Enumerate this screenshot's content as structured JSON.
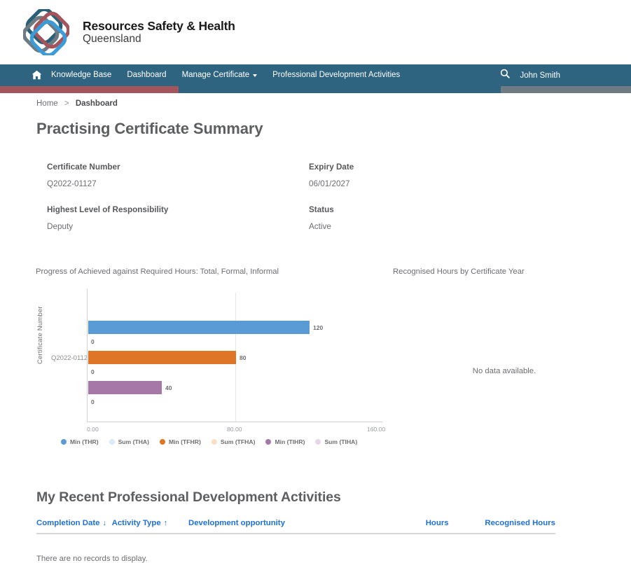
{
  "brand": {
    "line1": "Resources Safety & Health",
    "line2": "Queensland",
    "logo_colors": {
      "teal": "#2a6077",
      "grey": "#6f7b82",
      "red": "#a4555c",
      "blue": "#3b9cd9"
    }
  },
  "nav": {
    "home_icon": "home-icon",
    "items": [
      {
        "label": "Knowledge Base",
        "has_caret": false
      },
      {
        "label": "Dashboard",
        "has_caret": false
      },
      {
        "label": "Manage Certificate",
        "has_caret": true
      },
      {
        "label": "Professional Development Activities",
        "has_caret": false
      }
    ],
    "search_icon": "search-icon",
    "user": "John Smith",
    "user_caret": "▾",
    "bar_color": "#2e6480"
  },
  "stripe": {
    "red": "#a4555c",
    "teal": "#2e6480",
    "grey": "#6f7b82"
  },
  "breadcrumb": {
    "home": "Home",
    "separator": ">",
    "current": "Dashboard"
  },
  "page": {
    "title": "Practising Certificate Summary"
  },
  "details": [
    {
      "label": "Certificate Number",
      "value": "Q2022-01127"
    },
    {
      "label": "Expiry Date",
      "value": "06/01/2027"
    },
    {
      "label": "Highest Level of Responsibility",
      "value": "Deputy"
    },
    {
      "label": "Status",
      "value": "Active"
    }
  ],
  "charts": {
    "left_caption": "Progress of Achieved against Required Hours: Total, Formal, Informal",
    "right_caption": "Recognised Hours by Certificate Year",
    "no_data_message": "No data available."
  },
  "chart_data": {
    "type": "bar",
    "orientation": "horizontal",
    "title": "Progress of Achieved against Required Hours: Total, Formal, Informal",
    "xlabel": "",
    "ylabel": "Certificate Number",
    "categories": [
      "Q2022-01127"
    ],
    "xlim": [
      0,
      160
    ],
    "xticks": [
      "0.00",
      "80.00",
      "160.00"
    ],
    "xtick_values": [
      0,
      80,
      160
    ],
    "grid": "vertical-at-80",
    "legend_position": "bottom",
    "series": [
      {
        "name": "Min (THR)",
        "color": "#5b9bd5",
        "values": [
          120
        ],
        "label": "120"
      },
      {
        "name": "Sum (THA)",
        "color": "#dce9f6",
        "values": [
          0
        ],
        "label": "0"
      },
      {
        "name": "Min (TFHR)",
        "color": "#df7526",
        "values": [
          80
        ],
        "label": "80"
      },
      {
        "name": "Sum (TFHA)",
        "color": "#fadfc5",
        "values": [
          0
        ],
        "label": "0"
      },
      {
        "name": "Min (TIHR)",
        "color": "#a678a8",
        "values": [
          40
        ],
        "label": "40"
      },
      {
        "name": "Sum (TIHA)",
        "color": "#e6d7e7",
        "values": [
          0
        ],
        "label": "0"
      }
    ]
  },
  "activities": {
    "title": "My Recent Professional Development Activities",
    "columns": [
      {
        "label": "Completion Date",
        "sort": "↓"
      },
      {
        "label": "Activity Type",
        "sort": "↑"
      },
      {
        "label": "Development opportunity",
        "sort": ""
      },
      {
        "label": "Hours",
        "sort": ""
      },
      {
        "label": "Recognised Hours",
        "sort": ""
      }
    ],
    "empty_message": "There are no records to display.",
    "link_color": "#1f6fd4"
  }
}
